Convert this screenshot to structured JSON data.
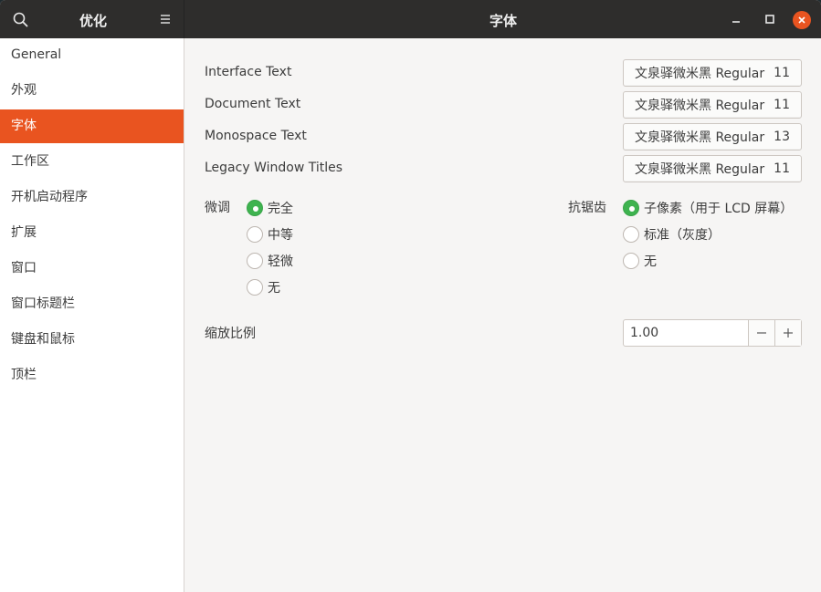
{
  "header": {
    "sidebar_title": "优化",
    "title": "字体",
    "search_icon": "search-icon",
    "menu_icon": "hamburger-menu-icon",
    "window_controls": [
      "minimize-icon",
      "maximize-icon",
      "close-icon"
    ],
    "accent_color": "#e95420"
  },
  "sidebar": {
    "items": [
      {
        "label": "General"
      },
      {
        "label": "外观"
      },
      {
        "label": "字体",
        "active": true
      },
      {
        "label": "工作区"
      },
      {
        "label": "开机启动程序"
      },
      {
        "label": "扩展"
      },
      {
        "label": "窗口"
      },
      {
        "label": "窗口标题栏"
      },
      {
        "label": "键盘和鼠标"
      },
      {
        "label": "顶栏"
      }
    ]
  },
  "fonts": {
    "rows": [
      {
        "label": "Interface Text",
        "font": "文泉驿微米黑 Regular",
        "size": "11"
      },
      {
        "label": "Document Text",
        "font": "文泉驿微米黑 Regular",
        "size": "11"
      },
      {
        "label": "Monospace Text",
        "font": "文泉驿微米黑 Regular",
        "size": "13"
      },
      {
        "label": "Legacy Window Titles",
        "font": "文泉驿微米黑 Regular",
        "size": "11"
      }
    ]
  },
  "hinting": {
    "label": "微调",
    "options": [
      {
        "label": "完全",
        "checked": true
      },
      {
        "label": "中等",
        "checked": false
      },
      {
        "label": "轻微",
        "checked": false
      },
      {
        "label": "无",
        "checked": false
      }
    ]
  },
  "antialiasing": {
    "label": "抗锯齿",
    "options": [
      {
        "label": "子像素（用于 LCD 屏幕）",
        "checked": true
      },
      {
        "label": "标准（灰度）",
        "checked": false
      },
      {
        "label": "无",
        "checked": false
      }
    ]
  },
  "scaling": {
    "label": "缩放比例",
    "value": "1.00",
    "decrement_icon": "minus-icon",
    "increment_icon": "plus-icon"
  },
  "colors": {
    "radio_checked": "#3eb34f",
    "headerbar": "#2e2d2c"
  }
}
